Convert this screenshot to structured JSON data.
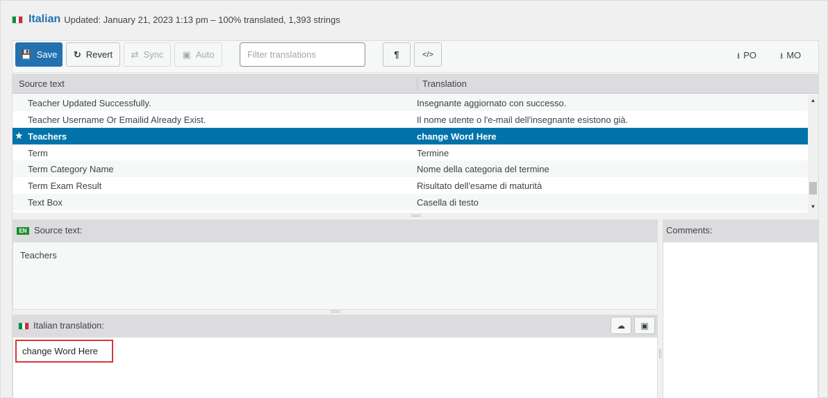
{
  "header": {
    "language": "Italian",
    "updated": "Updated: January 21, 2023 1:13 pm – 100% translated, 1,393 strings"
  },
  "toolbar": {
    "save": "Save",
    "revert": "Revert",
    "sync": "Sync",
    "auto": "Auto",
    "filter_placeholder": "Filter translations",
    "pilcrow": "¶",
    "code": "</>",
    "download_po": "PO",
    "download_mo": "MO"
  },
  "table": {
    "headers": {
      "source": "Source text",
      "translation": "Translation"
    },
    "rows": [
      {
        "source": "Teacher Updated Successfully.",
        "translation": "Insegnante aggiornato con successo."
      },
      {
        "source": "Teacher Username Or Emailid Already Exist.",
        "translation": "Il nome utente o l'e-mail dell'insegnante esistono già."
      },
      {
        "source": "Teachers",
        "translation": "change Word Here",
        "selected": true
      },
      {
        "source": "Term",
        "translation": "Termine"
      },
      {
        "source": "Term Category Name",
        "translation": "Nome della categoria del termine"
      },
      {
        "source": "Term Exam Result",
        "translation": "Risultato dell'esame di maturità"
      },
      {
        "source": "Text Box",
        "translation": "Casella di testo"
      }
    ]
  },
  "source_panel": {
    "badge": "EN",
    "title": "Source text:",
    "text": "Teachers"
  },
  "translation_panel": {
    "title": "Italian translation:",
    "value": "change Word Here"
  },
  "comments_panel": {
    "title": "Comments:"
  },
  "colors": {
    "primary": "#2271b1",
    "selected_row": "#0073aa",
    "highlight_border": "#d63638"
  }
}
